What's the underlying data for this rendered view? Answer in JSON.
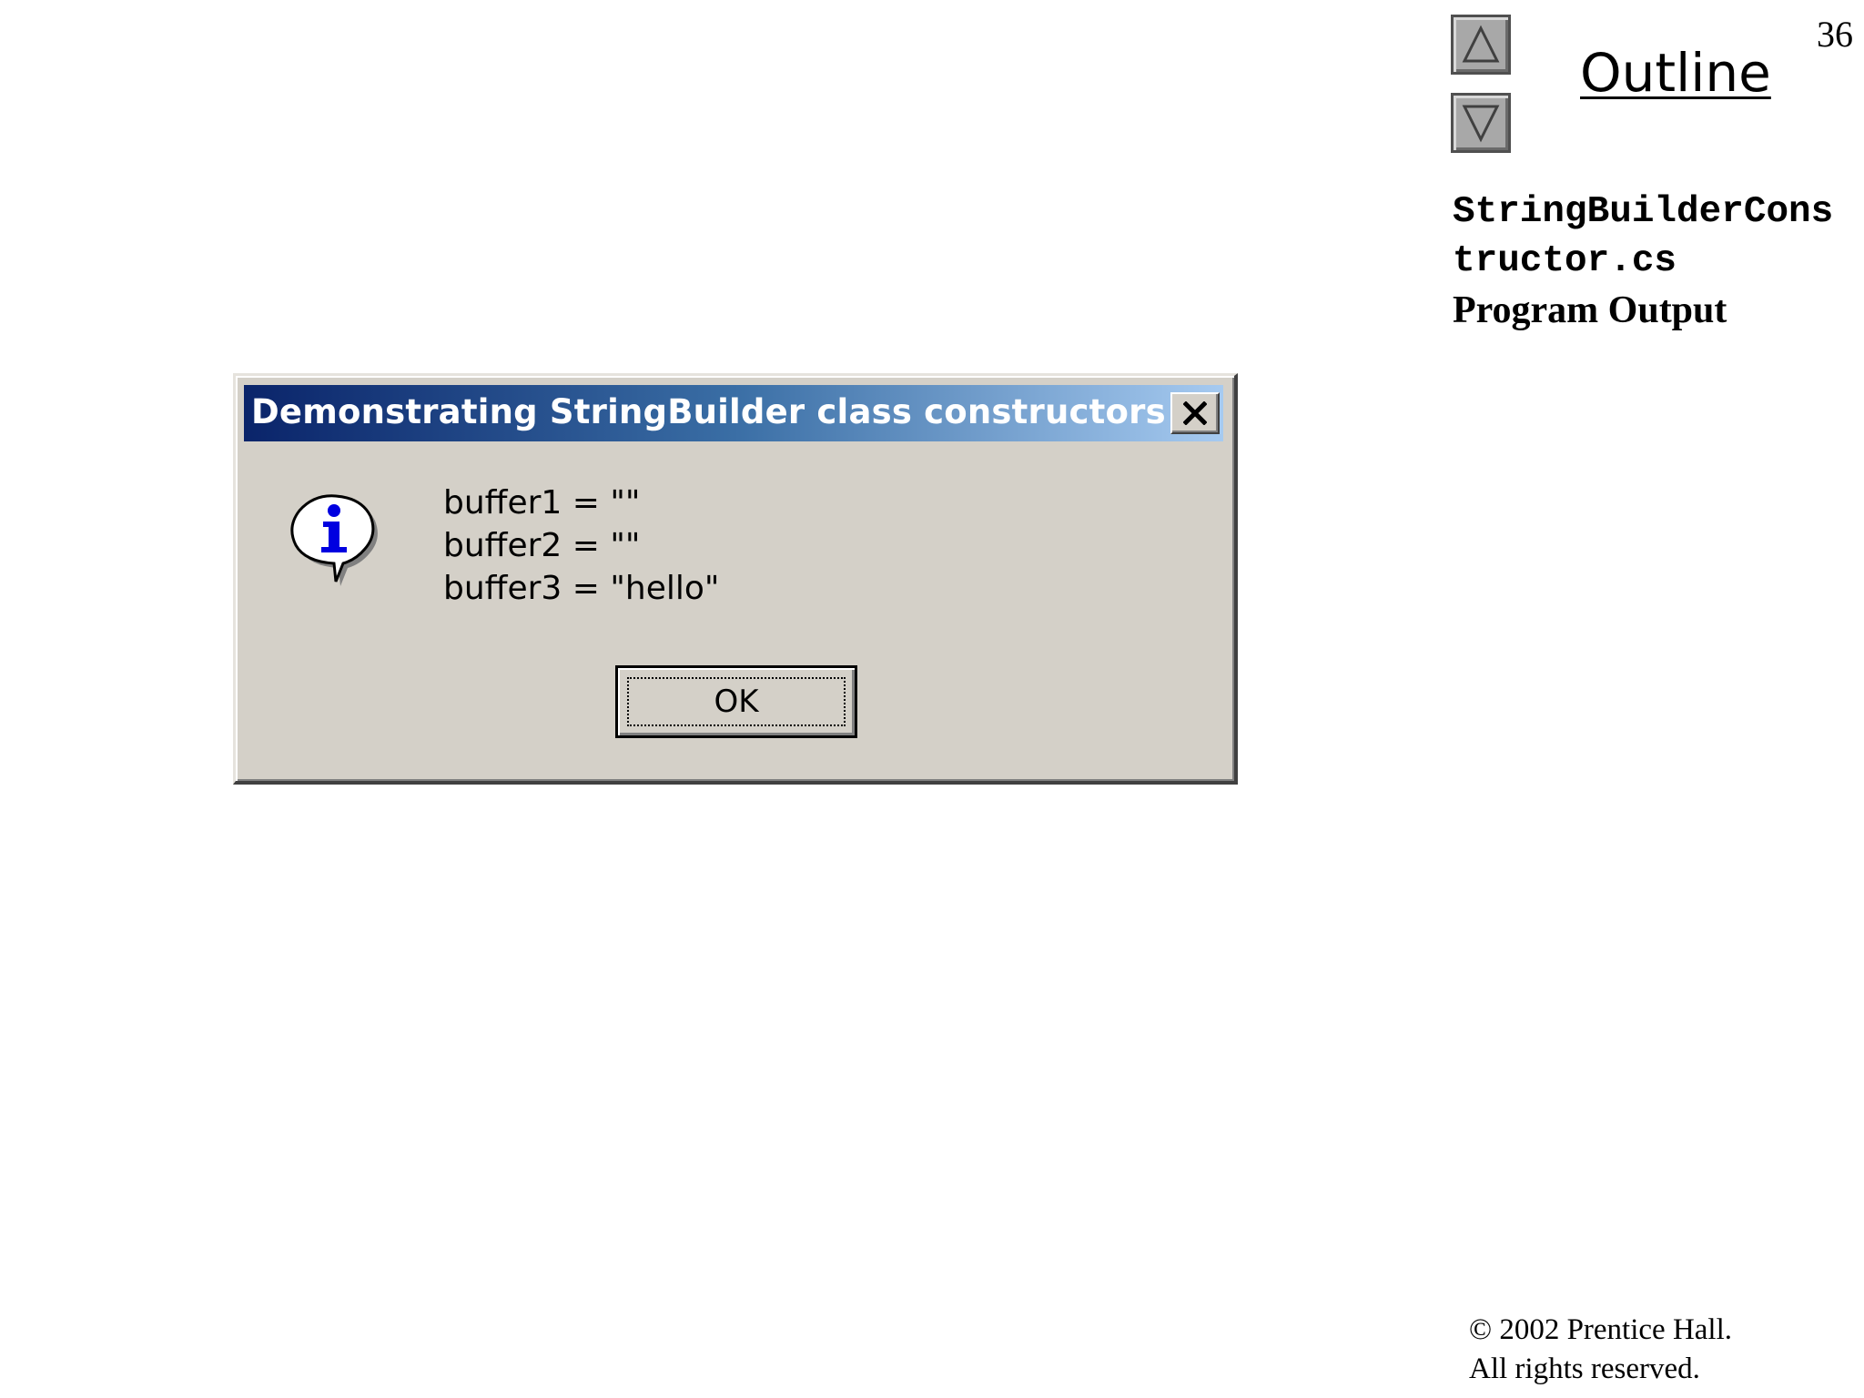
{
  "slide": {
    "number": "36",
    "outline_label": "Outline",
    "file_name": "StringBuilderConstructor.cs",
    "section_label": "Program Output",
    "copyright_line1": "© 2002 Prentice Hall.",
    "copyright_line2": "All rights reserved."
  },
  "nav": {
    "up_icon": "triangle-up-icon",
    "down_icon": "triangle-down-icon"
  },
  "dialog": {
    "title": "Demonstrating StringBuilder class constructors",
    "close_icon": "close-icon",
    "icon": "info-icon",
    "lines": [
      "buffer1 = \"\"",
      "buffer2 = \"\"",
      "buffer3 = \"hello\""
    ],
    "ok_label": "OK"
  },
  "colors": {
    "titlebar_start": "#0a246a",
    "titlebar_end": "#a6caf0",
    "dialog_face": "#d4d0c8",
    "nav_button": "#a8a8a8"
  }
}
